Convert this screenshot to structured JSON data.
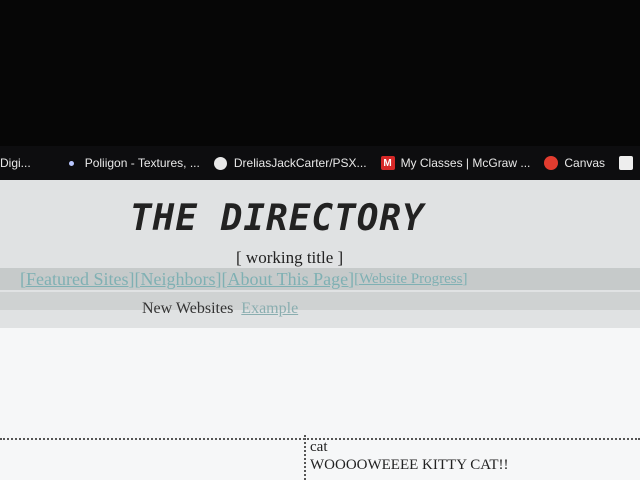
{
  "bookmarks": [
    {
      "icon": "none",
      "label": "Digi..."
    },
    {
      "icon": "dot-icon",
      "label": "Poliigon - Textures, ..."
    },
    {
      "icon": "github-icon",
      "label": "DreliasJackCarter/PSX..."
    },
    {
      "icon": "mcgraw-icon",
      "label": "My Classes | McGraw ..."
    },
    {
      "icon": "canvas-icon",
      "label": "Canvas"
    },
    {
      "icon": "square-icon",
      "label": ""
    }
  ],
  "page": {
    "title": "THE DIRECTORY",
    "subtitle": "[ working title ]",
    "nav": {
      "featured": "[Featured Sites]",
      "neighbors": "[Neighbors]",
      "about": "[About This Page]",
      "progress": "[Website Progress]"
    },
    "new_websites": "New Websites",
    "example_link": "Example",
    "post": {
      "title": "cat",
      "body": "WOOOOWEEEE KITTY CAT!!"
    }
  },
  "colors": {
    "link": "#7fb0b3",
    "header_bg": "#e0e2e3",
    "nav_bg": "#c6caca"
  }
}
